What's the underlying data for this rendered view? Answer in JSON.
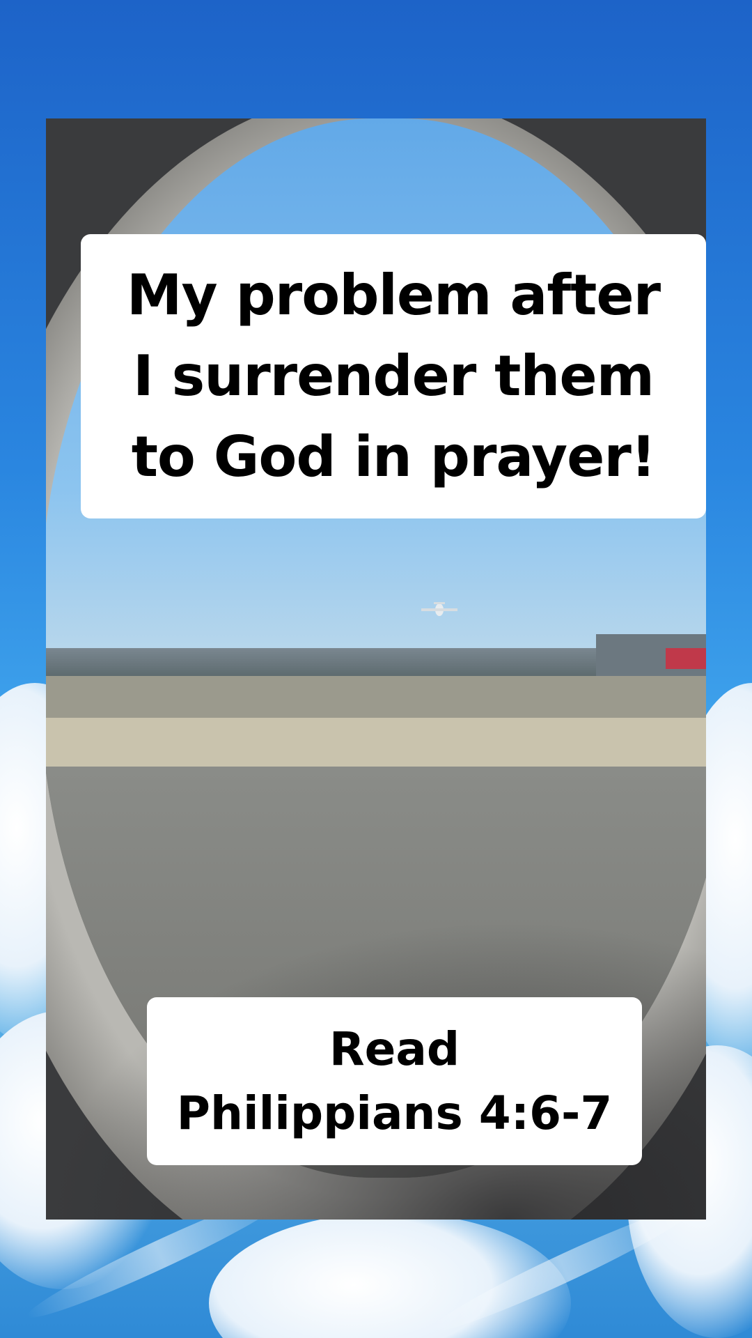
{
  "caption_top": {
    "text": "My problem after\nI surrender them\nto God in prayer!"
  },
  "caption_bottom": {
    "text": "Read\nPhilippians 4:6-7"
  },
  "colors": {
    "caption_background": "#ffffff",
    "caption_text": "#000000",
    "sky_blue": "#2a86e0"
  }
}
